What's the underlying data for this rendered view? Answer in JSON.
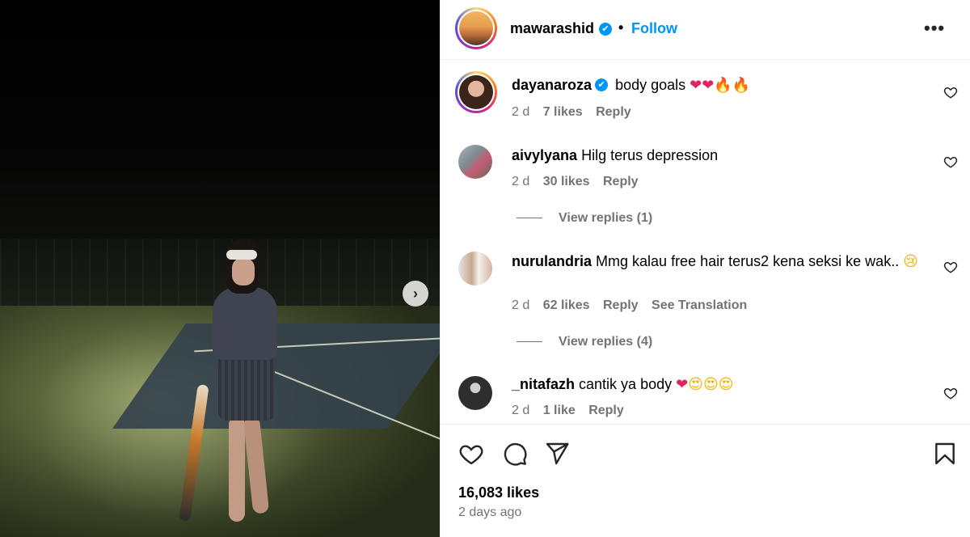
{
  "post": {
    "owner": {
      "username": "mawarashid",
      "verified_mark": "✔",
      "separator": "•",
      "follow_label": "Follow",
      "more_label": "•••"
    },
    "carousel_next_label": "›"
  },
  "comments": [
    {
      "username": "dayanaroza",
      "verified": true,
      "text": "body goals",
      "emojis": [
        {
          "glyph": "❤",
          "cls": "e-heart"
        },
        {
          "glyph": "❤",
          "cls": "e-heart"
        },
        {
          "glyph": "🔥",
          "cls": "e-fire"
        },
        {
          "glyph": "🔥",
          "cls": "e-fire"
        }
      ],
      "age": "2 d",
      "likes": "7 likes",
      "reply": "Reply"
    },
    {
      "username": "aivylyana",
      "verified": false,
      "text": "Hilg terus depression",
      "emojis": [],
      "age": "2 d",
      "likes": "30 likes",
      "reply": "Reply",
      "view_replies": "View replies (1)"
    },
    {
      "username": "nurulandria",
      "verified": false,
      "text": "Mmg kalau free hair terus2 kena seksi ke wak..",
      "emojis": [
        {
          "glyph": "😢",
          "cls": "e-eyes"
        }
      ],
      "age": "2 d",
      "likes": "62 likes",
      "reply": "Reply",
      "translate": "See Translation",
      "view_replies": "View replies (4)"
    },
    {
      "username": "_nitafazh",
      "verified": false,
      "text": "cantik ya body",
      "emojis": [
        {
          "glyph": "❤",
          "cls": "e-heart"
        },
        {
          "glyph": "😍",
          "cls": "e-eyes"
        },
        {
          "glyph": "😍",
          "cls": "e-eyes"
        },
        {
          "glyph": "😍",
          "cls": "e-eyes"
        }
      ],
      "age": "2 d",
      "likes": "1 like",
      "reply": "Reply"
    }
  ],
  "footer": {
    "like_count": "16,083 likes",
    "posted": "2 days ago",
    "icons": [
      "heart-icon",
      "comment-icon",
      "share-icon",
      "bookmark-icon"
    ]
  },
  "colors": {
    "accent": "#0095f6",
    "muted": "#737373",
    "heart": "#e0245e"
  }
}
